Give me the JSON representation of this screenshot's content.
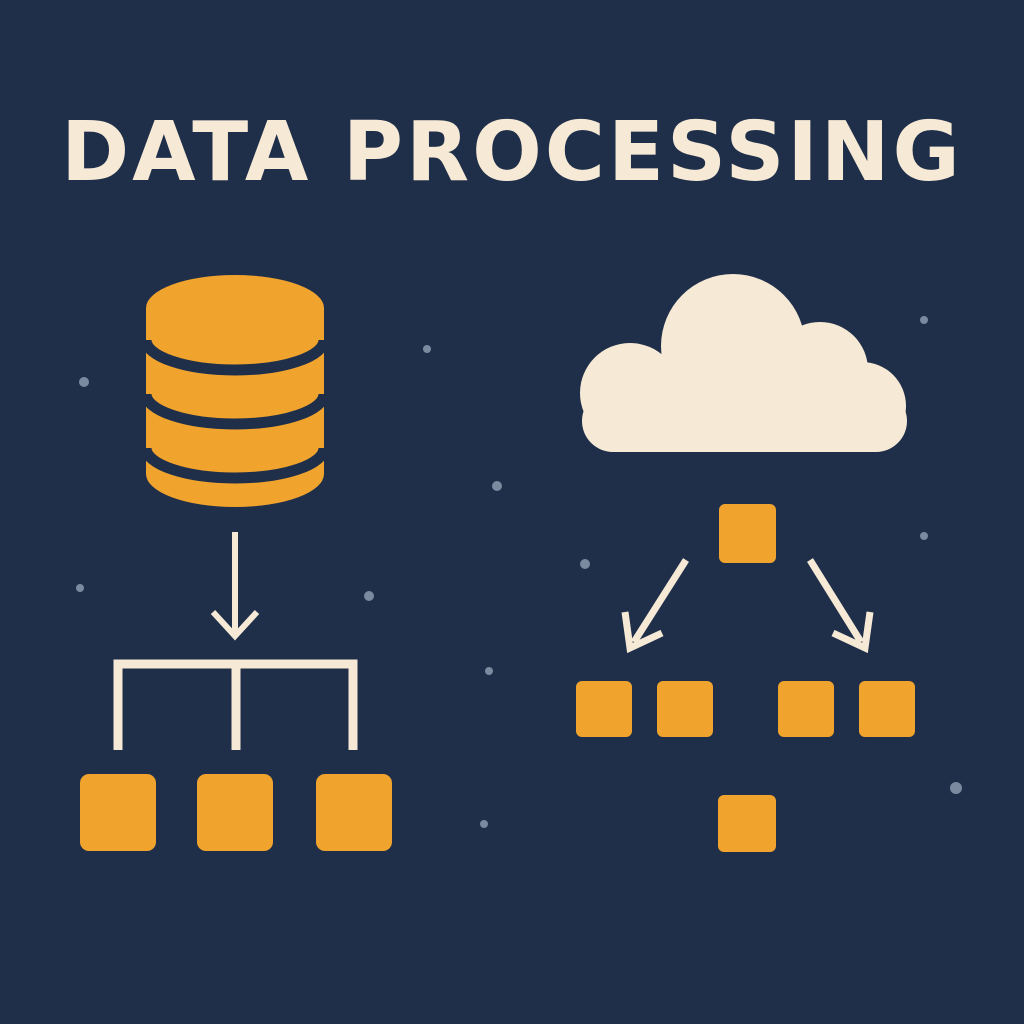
{
  "title": "DATA PROCESSING",
  "colors": {
    "background": "#1f2f4a",
    "accent": "#f0a32d",
    "light": "#f6ead6",
    "dots": "#7c8aa0"
  },
  "icons": [
    "database-icon",
    "cloud-icon",
    "arrow-down-icon",
    "tree-connector",
    "block"
  ]
}
